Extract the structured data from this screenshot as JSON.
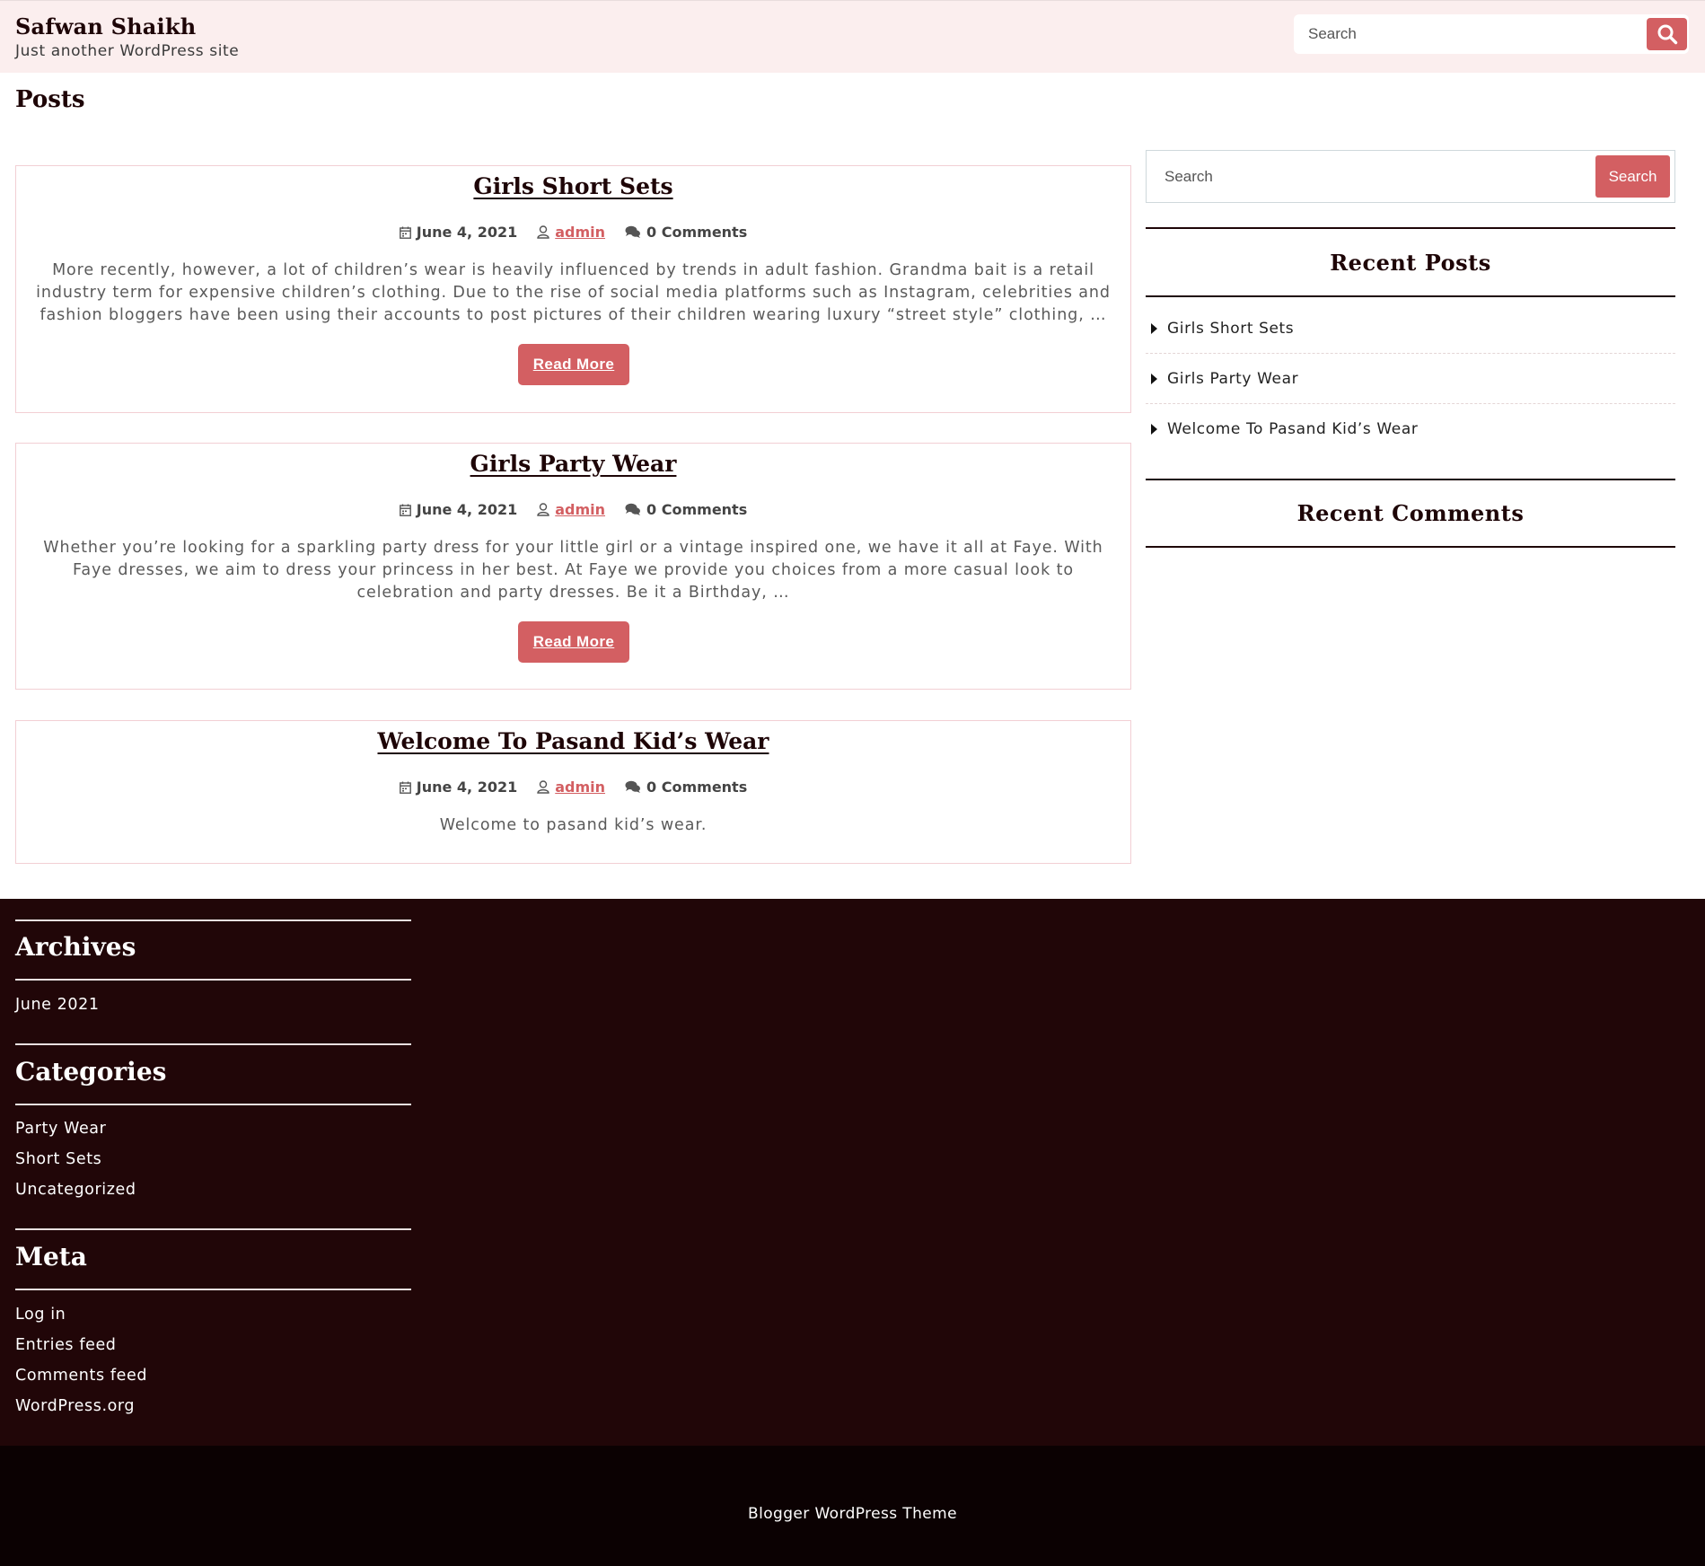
{
  "site": {
    "title": "Safwan Shaikh",
    "tagline": "Just another WordPress site"
  },
  "header_search": {
    "placeholder": "Search",
    "button_icon": "search-icon"
  },
  "page": {
    "title": "Posts"
  },
  "posts": [
    {
      "title": "Girls Short Sets",
      "date": "June 4, 2021",
      "author": "admin",
      "comments": "0 Comments",
      "excerpt": "More recently, however, a lot of children’s wear is heavily influenced by trends in adult fashion. Grandma bait is a retail industry term for expensive children’s clothing. Due to the rise of social media platforms such as Instagram, celebrities and fashion bloggers have been using their accounts to post pictures of their children wearing luxury “street style” clothing, …",
      "read_more": "Read More"
    },
    {
      "title": "Girls Party Wear",
      "date": "June 4, 2021",
      "author": "admin",
      "comments": "0 Comments",
      "excerpt": "Whether you’re looking for a sparkling party dress for your little girl or a vintage inspired one, we have it all at Faye. With Faye dresses, we aim to dress your princess in her best. At Faye we provide you choices from a more casual look to celebration and party dresses. Be it a Birthday, …",
      "read_more": "Read More"
    },
    {
      "title": "Welcome To Pasand Kid’s Wear",
      "date": "June 4, 2021",
      "author": "admin",
      "comments": "0 Comments",
      "excerpt": "Welcome to pasand kid’s wear."
    }
  ],
  "sidebar": {
    "search_placeholder": "Search",
    "search_button": "Search",
    "recent_posts_heading": "Recent Posts",
    "recent_posts": [
      "Girls Short Sets",
      "Girls Party Wear",
      "Welcome To Pasand Kid’s Wear"
    ],
    "recent_comments_heading": "Recent Comments"
  },
  "footer": {
    "archives_heading": "Archives",
    "archives": [
      "June 2021"
    ],
    "categories_heading": "Categories",
    "categories": [
      "Party Wear",
      "Short Sets",
      "Uncategorized"
    ],
    "meta_heading": "Meta",
    "meta": [
      "Log in",
      "Entries feed",
      "Comments feed",
      "WordPress.org"
    ],
    "credit": "Blogger WordPress Theme"
  },
  "colors": {
    "accent": "#d35f62",
    "header_bg": "#fbeeee",
    "footer_bg": "#210608",
    "footer_bottom_bg": "#0b0102",
    "heading": "#1e0507"
  }
}
